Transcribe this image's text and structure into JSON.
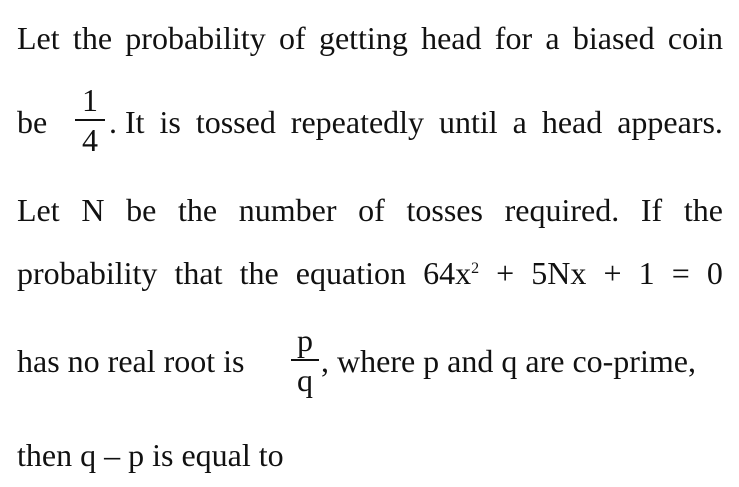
{
  "problem": {
    "line1": {
      "words": [
        "Let",
        "the",
        "probability",
        "of",
        "getting",
        "head",
        "for",
        "a",
        "biased",
        "coin"
      ]
    },
    "line2": {
      "before": "be",
      "frac_num": "1",
      "frac_den": "4",
      "after_words": [
        ". It",
        "is",
        "tossed",
        "repeatedly",
        "until",
        "a",
        "head",
        "appears."
      ]
    },
    "line3": {
      "words": [
        "Let",
        "N",
        "be",
        "the",
        "number",
        "of",
        "tosses",
        "required.",
        "If",
        "the"
      ]
    },
    "line4": {
      "words": [
        "probability",
        "that",
        "the",
        "equation"
      ],
      "equation_coeff": "64x",
      "equation_exp": "2",
      "equation_rest": [
        "+",
        "5Nx",
        "+",
        "1",
        "=",
        "0"
      ]
    },
    "line5": {
      "before": "has no real root is",
      "frac_num": "p",
      "frac_den": "q",
      "after": ", where p and q are co-prime,"
    },
    "line6": {
      "text": "then q – p is equal to"
    }
  }
}
